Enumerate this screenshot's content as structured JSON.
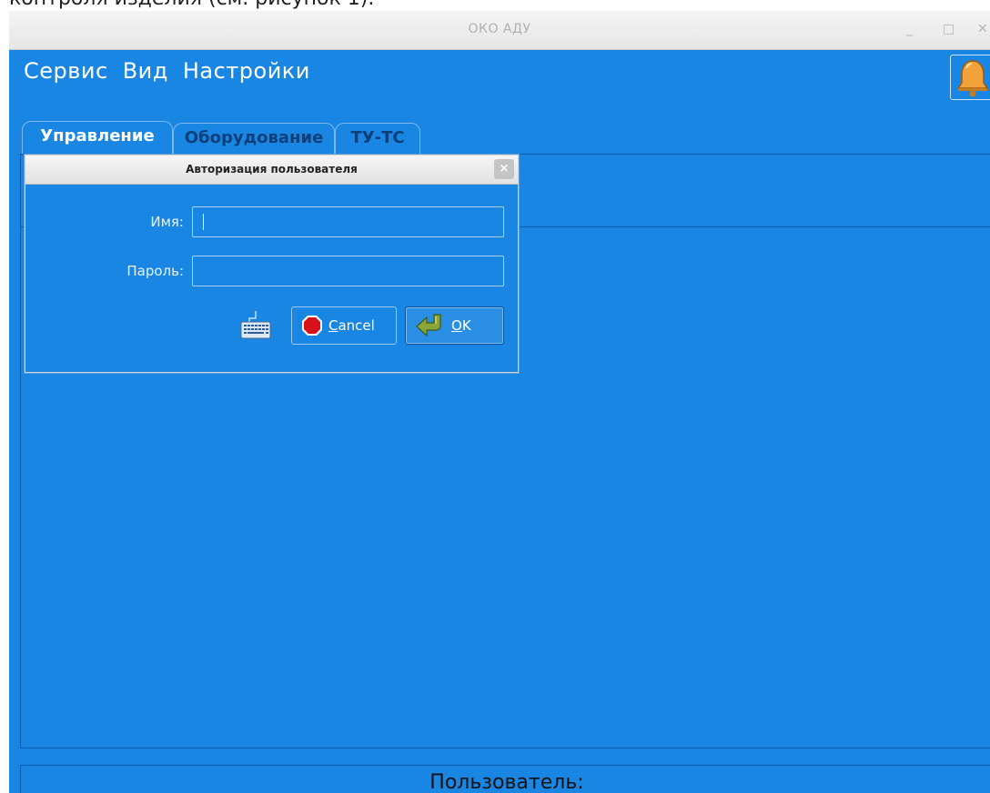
{
  "doc_text": "контроля изделия (см. рисунок 1).",
  "window": {
    "title": "ОКО АДУ",
    "minimize_glyph": "_",
    "maximize_glyph": "□",
    "close_glyph": "✕"
  },
  "menu": {
    "items": [
      {
        "label": "Сервис"
      },
      {
        "label": "Вид"
      },
      {
        "label": "Настройки"
      }
    ]
  },
  "tabs": [
    {
      "label": "Управление",
      "active": true
    },
    {
      "label": "Оборудование",
      "active": false
    },
    {
      "label": "ТУ-ТС",
      "active": false
    }
  ],
  "dialog": {
    "title": "Авторизация пользователя",
    "close_glyph": "×",
    "name_label": "Имя:",
    "name_value": "",
    "password_label": "Пароль:",
    "password_value": "",
    "cancel_mnemonic": "C",
    "cancel_rest": "ancel",
    "ok_mnemonic": "O",
    "ok_rest": "K"
  },
  "statusbar": {
    "user_label": "Пользователь:"
  },
  "icons": {
    "bell": "bell-icon",
    "keyboard": "keyboard-icon",
    "cancel": "stop-icon",
    "ok": "return-arrow-icon"
  },
  "colors": {
    "background": "#1a86e3",
    "dialog_titlebar": "#e6e6e6",
    "stop_red": "#d8101a",
    "ok_arrow_green": "#8aa63a",
    "bell_orange": "#f2a23a"
  }
}
